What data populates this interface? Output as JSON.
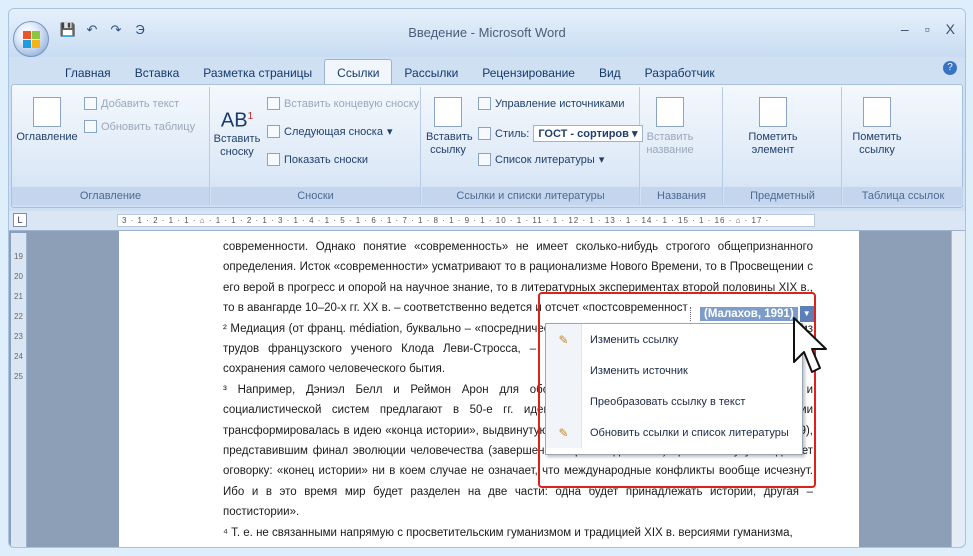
{
  "window": {
    "title": "Введение - Microsoft Word",
    "controls": [
      "–",
      "▫",
      "X"
    ]
  },
  "qat": {
    "items": [
      "💾",
      "↶",
      "↷",
      "Э"
    ]
  },
  "tabs": [
    "Главная",
    "Вставка",
    "Разметка страницы",
    "Ссылки",
    "Рассылки",
    "Рецензирование",
    "Вид",
    "Разработчик"
  ],
  "active_tab": "Ссылки",
  "ribbon": {
    "toc": {
      "big": "Оглавление",
      "add_text": "Добавить текст",
      "update": "Обновить таблицу",
      "label": "Оглавление"
    },
    "footnotes": {
      "insert_big": "Вставить сноску",
      "insert_end": "Вставить концевую сноску",
      "next": "Следующая сноска",
      "show": "Показать сноски",
      "label": "Сноски"
    },
    "citations": {
      "insert_big": "Вставить ссылку",
      "manage": "Управление источниками",
      "style_label": "Стиль:",
      "style_value": "ГОСТ - сортиров",
      "biblio": "Список литературы",
      "label": "Ссылки и списки литературы"
    },
    "captions": {
      "big": "Вставить название",
      "label": "Названия"
    },
    "index": {
      "big": "Пометить элемент",
      "label": "Предметный указатель"
    },
    "toa": {
      "big": "Пометить ссылку",
      "label": "Таблица ссылок"
    }
  },
  "ruler": {
    "scale": "3 · 1 · 2 · 1 · 1 · ⌂ · 1 · 1 · 2 · 1 · 3 · 1 · 4 · 1 · 5 · 1 · 6 · 1 · 7 · 1 · 8 · 1 · 9 · 1 · 10 · 1 · 11 · 1 · 12 · 1 · 13 · 1 · 14 · 1 · 15 · 1 · 16 · ⌂ · 17 ·"
  },
  "vruler": [
    "19",
    "20",
    "21",
    "22",
    "23",
    "24",
    "25"
  ],
  "doc": {
    "p1": "современности. Однако понятие «современность» не имеет сколько-нибудь строгого общепризнанного определения. Исток «современности» усматривают то в рационализме Нового Времени, то в Просвещении с его верой в прогресс и опорой на научное знание, то в литературных экспериментах второй половины XIX в., то в авангарде 10–20-х гг. XX в. – соответственно ведется и отсчет «постсовременност",
    "p2": "² Медиация (от франц. médiation, буквально – «посредничество») – понятие, вошедшее в научный обиход из трудов французского ученого Клода Леви-Стросса, – процесс снятия противоположностей с целью сохранения самого человеческого бытия.",
    "p3": "³ Например, Дэниэл Белл и Реймон Арон для обоснования конвергенции капиталистической и социалистической систем предлагают в 50-е гг. идею «конца идеологии», которая впоследствии трансформировалась в идею «конца истории», выдвинутую Фрэнсисом Фукуямой («Конец истории?», 1989), представившим финал эволюции человечества (завершение борьбы идеологий) при этом Фукуяма делает оговорку: «конец истории» ни в коем случае не означает, что международные конфликты вообще исчезнут. Ибо и в это время мир будет разделен на две части: одна будет принадлежать истории, другая – постистории».",
    "p4": "⁴ Т. е. не связанными напрямую с просветительским гуманизмом и традицией XIX в. версиями гуманизма,"
  },
  "citation": "(Малахов, 1991)",
  "context_menu": [
    {
      "label": "Изменить ссылку",
      "icon": "edit-citation-icon"
    },
    {
      "label": "Изменить источник",
      "icon": ""
    },
    {
      "label": "Преобразовать ссылку в текст",
      "icon": ""
    },
    {
      "label": "Обновить ссылки и список литературы",
      "icon": "update-icon"
    }
  ]
}
